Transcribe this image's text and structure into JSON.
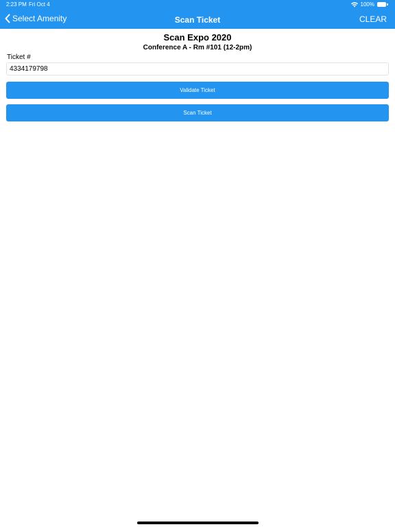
{
  "status_bar": {
    "time": "2:23 PM",
    "date": "Fri Oct 4",
    "battery": "100%",
    "icons": [
      "wifi-icon",
      "battery-icon"
    ]
  },
  "nav": {
    "back_label": "Select Amenity",
    "back_icon": "chevron-left-icon",
    "title": "Scan Ticket",
    "clear_label": "CLEAR"
  },
  "event": {
    "title": "Scan Expo 2020",
    "subtitle": "Conference A - Rm #101 (12-2pm)"
  },
  "ticket": {
    "label": "Ticket #",
    "value": "4334179798"
  },
  "actions": {
    "validate_label": "Validate Ticket",
    "scan_label": "Scan Ticket"
  },
  "colors": {
    "accent": "#2394f0",
    "background": "#ffffff"
  }
}
